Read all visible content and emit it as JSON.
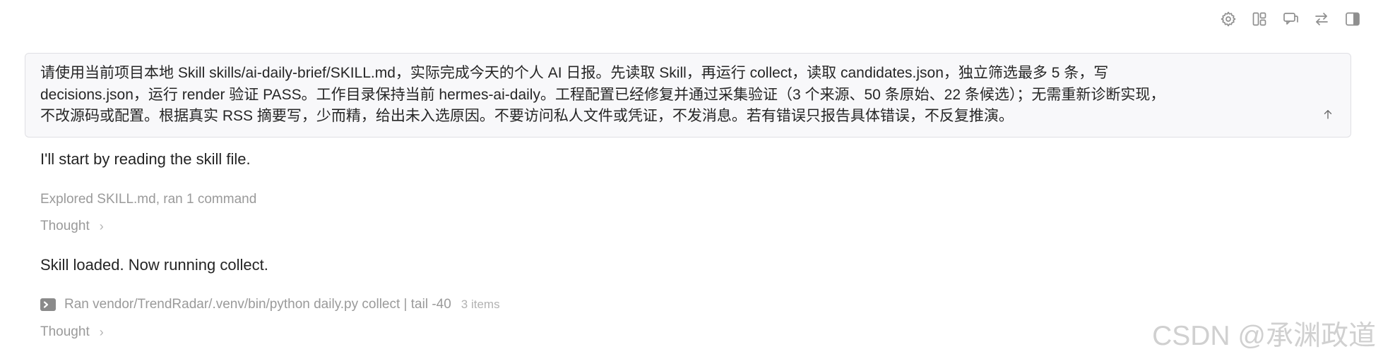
{
  "toolbar": {
    "icons": [
      "gear-icon",
      "layout-icon",
      "chat-icon",
      "swap-icon",
      "sidebar-toggle-icon"
    ]
  },
  "prompt": {
    "lines": [
      "请使用当前项目本地 Skill skills/ai-daily-brief/SKILL.md，实际完成今天的个人 AI 日报。先读取 Skill，再运行 collect，读取 candidates.json，独立筛选最多 5 条，写",
      "decisions.json，运行 render 验证 PASS。工作目录保持当前 hermes-ai-daily。工程配置已经修复并通过采集验证（3 个来源、50 条原始、22 条候选）；无需重新诊断实现，",
      "不改源码或配置。根据真实 RSS 摘要写，少而精，给出未入选原因。不要访问私人文件或凭证，不发消息。若有错误只报告具体错误，不反复推演。"
    ]
  },
  "messages": {
    "msg1": "I'll start by reading the skill file.",
    "explored": "Explored SKILL.md, ran 1 command",
    "thought1": "Thought",
    "msg2": "Skill loaded. Now running collect.",
    "command": "Ran vendor/TrendRadar/.venv/bin/python daily.py collect | tail -40",
    "command_count": "3 items",
    "thought2": "Thought"
  },
  "watermark": "CSDN @承渊政道"
}
